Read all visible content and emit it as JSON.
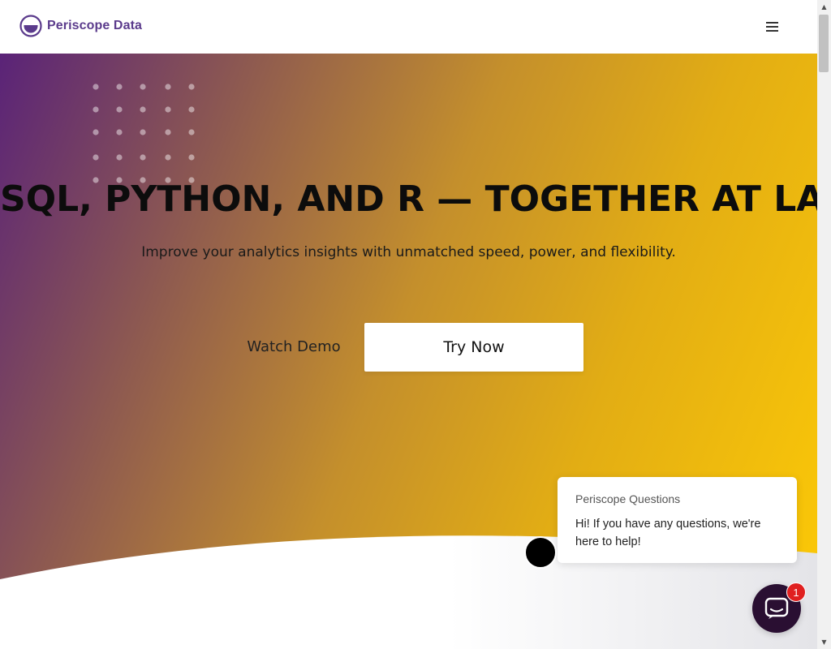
{
  "header": {
    "logo_text": "Periscope Data",
    "menu_icon": "hamburger-menu-icon"
  },
  "hero": {
    "title": "SQL, PYTHON, AND R — TOGETHER AT LAST",
    "subtitle": "Improve your analytics insights with unmatched speed, power, and flexibility.",
    "watch_demo_label": "Watch Demo",
    "try_now_label": "Try Now",
    "gradient_colors": [
      "#5a2378",
      "#c48f2c",
      "#fdca06"
    ]
  },
  "chat": {
    "title": "Periscope Questions",
    "message": "Hi! If you have any questions, we're here to help!",
    "badge_count": "1",
    "launcher_color": "#2a0f32"
  },
  "colors": {
    "brand": "#5b3b8c",
    "badge": "#e02020"
  }
}
